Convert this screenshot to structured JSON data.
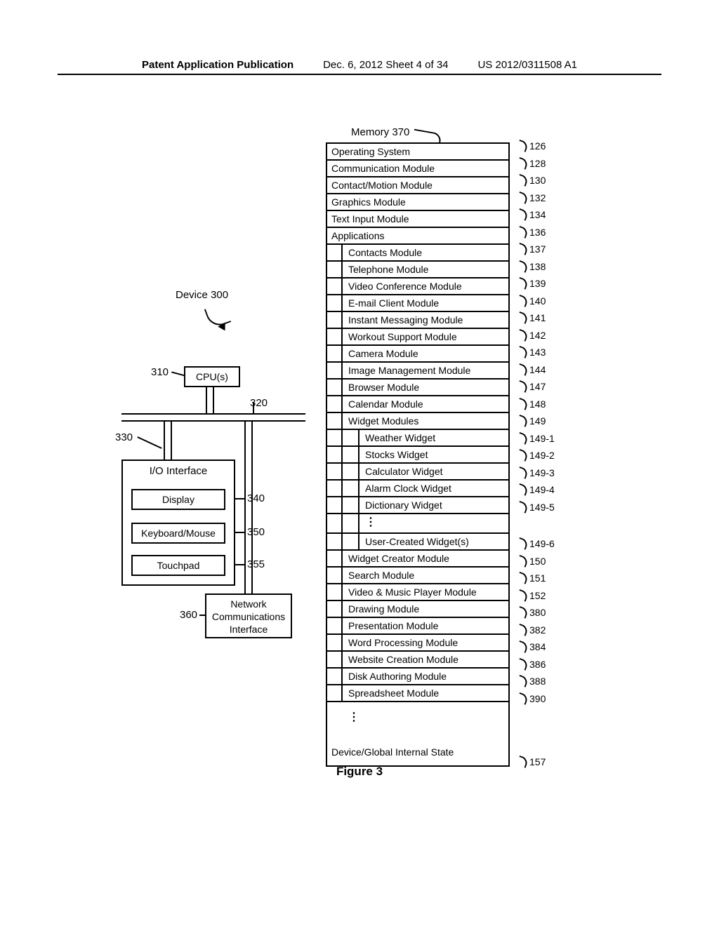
{
  "header": {
    "left": "Patent Application Publication",
    "center": "Dec. 6, 2012   Sheet 4 of 34",
    "right": "US 2012/0311508 A1"
  },
  "figure_caption": "Figure 3",
  "device": {
    "title": "Device 300",
    "cpu": "CPU(s)",
    "io_title": "I/O Interface",
    "display": "Display",
    "keyboard_mouse": "Keyboard/Mouse",
    "touchpad": "Touchpad",
    "network": "Network\nCommunications\nInterface",
    "refs": {
      "cpu": "310",
      "bus": "320",
      "io": "330",
      "display": "340",
      "keyboard_mouse": "350",
      "touchpad": "355",
      "network": "360"
    }
  },
  "memory": {
    "title": "Memory 370",
    "rows": [
      {
        "label": "Operating System",
        "ref": "126",
        "indent": 0
      },
      {
        "label": "Communication Module",
        "ref": "128",
        "indent": 0
      },
      {
        "label": "Contact/Motion Module",
        "ref": "130",
        "indent": 0
      },
      {
        "label": "Graphics Module",
        "ref": "132",
        "indent": 0
      },
      {
        "label": "Text Input Module",
        "ref": "134",
        "indent": 0
      },
      {
        "label": "Applications",
        "ref": "136",
        "indent": 0
      },
      {
        "label": "Contacts Module",
        "ref": "137",
        "indent": 1
      },
      {
        "label": "Telephone Module",
        "ref": "138",
        "indent": 1
      },
      {
        "label": "Video Conference Module",
        "ref": "139",
        "indent": 1
      },
      {
        "label": "E-mail Client Module",
        "ref": "140",
        "indent": 1
      },
      {
        "label": "Instant Messaging Module",
        "ref": "141",
        "indent": 1
      },
      {
        "label": "Workout Support Module",
        "ref": "142",
        "indent": 1
      },
      {
        "label": "Camera Module",
        "ref": "143",
        "indent": 1
      },
      {
        "label": "Image Management Module",
        "ref": "144",
        "indent": 1
      },
      {
        "label": "Browser Module",
        "ref": "147",
        "indent": 1
      },
      {
        "label": "Calendar Module",
        "ref": "148",
        "indent": 1
      },
      {
        "label": "Widget Modules",
        "ref": "149",
        "indent": 1
      },
      {
        "label": "Weather Widget",
        "ref": "149-1",
        "indent": 2
      },
      {
        "label": "Stocks Widget",
        "ref": "149-2",
        "indent": 2
      },
      {
        "label": "Calculator Widget",
        "ref": "149-3",
        "indent": 2
      },
      {
        "label": "Alarm Clock Widget",
        "ref": "149-4",
        "indent": 2
      },
      {
        "label": "Dictionary Widget",
        "ref": "149-5",
        "indent": 2
      },
      {
        "label": "User-Created Widget(s)",
        "ref": "149-6",
        "indent": 2
      },
      {
        "label": "Widget Creator Module",
        "ref": "150",
        "indent": 1
      },
      {
        "label": "Search Module",
        "ref": "151",
        "indent": 1
      },
      {
        "label": "Video & Music Player Module",
        "ref": "152",
        "indent": 1
      },
      {
        "label": "Drawing Module",
        "ref": "380",
        "indent": 1
      },
      {
        "label": "Presentation Module",
        "ref": "382",
        "indent": 1
      },
      {
        "label": "Word Processing  Module",
        "ref": "384",
        "indent": 1
      },
      {
        "label": "Website Creation Module",
        "ref": "386",
        "indent": 1
      },
      {
        "label": "Disk Authoring Module",
        "ref": "388",
        "indent": 1
      },
      {
        "label": "Spreadsheet Module",
        "ref": "390",
        "indent": 1
      }
    ],
    "global_state": {
      "label": "Device/Global Internal State",
      "ref": "157"
    }
  }
}
